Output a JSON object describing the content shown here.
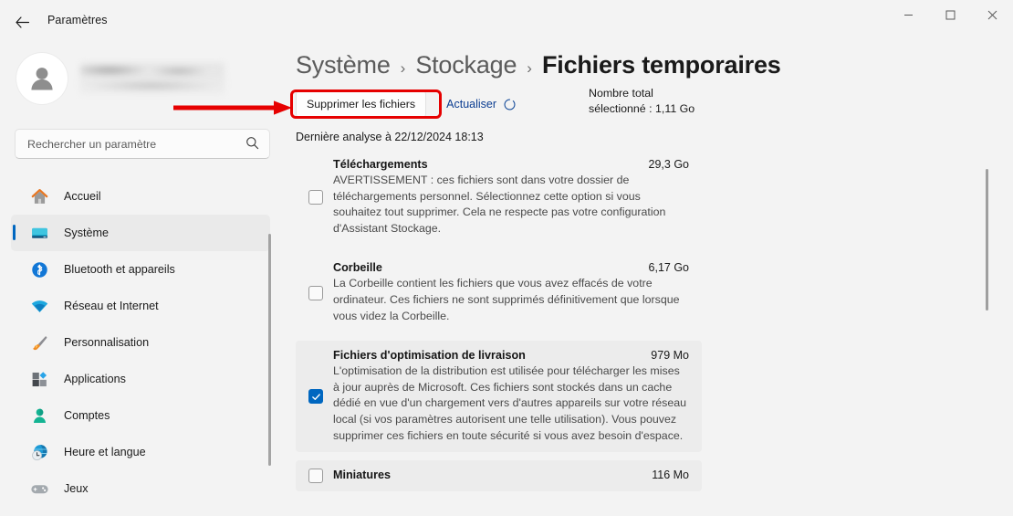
{
  "window": {
    "title": "Paramètres",
    "back_icon": "back-arrow-icon",
    "minimize_icon": "minimize-icon",
    "maximize_icon": "maximize-icon",
    "close_icon": "close-icon"
  },
  "sidebar": {
    "account": {
      "avatar_icon": "person-avatar-icon",
      "name_redacted": ""
    },
    "search": {
      "placeholder": "Rechercher un paramètre",
      "value": "",
      "icon": "search-icon"
    },
    "items": [
      {
        "label": "Accueil",
        "icon": "home-icon",
        "selected": false
      },
      {
        "label": "Système",
        "icon": "monitor-icon",
        "selected": true
      },
      {
        "label": "Bluetooth et appareils",
        "icon": "bluetooth-icon",
        "selected": false
      },
      {
        "label": "Réseau et Internet",
        "icon": "wifi-icon",
        "selected": false
      },
      {
        "label": "Personnalisation",
        "icon": "paintbrush-icon",
        "selected": false
      },
      {
        "label": "Applications",
        "icon": "apps-icon",
        "selected": false
      },
      {
        "label": "Comptes",
        "icon": "account-icon",
        "selected": false
      },
      {
        "label": "Heure et langue",
        "icon": "clock-globe-icon",
        "selected": false
      },
      {
        "label": "Jeux",
        "icon": "gamepad-icon",
        "selected": false
      }
    ]
  },
  "main": {
    "breadcrumb": {
      "parent": "Système",
      "middle": "Stockage",
      "current": "Fichiers temporaires",
      "separator": "›"
    },
    "delete_button": "Supprimer les fichiers",
    "refresh_link": "Actualiser",
    "refresh_icon": "refresh-spinner-icon",
    "total_label_line1": "Nombre total",
    "total_label_line2": "sélectionné : 1,11 Go",
    "last_scan": "Dernière analyse à 22/12/2024 18:13",
    "items": [
      {
        "title": "Téléchargements",
        "size": "29,3 Go",
        "checked": false,
        "highlight": false,
        "description": "AVERTISSEMENT : ces fichiers sont dans votre dossier de téléchargements personnel. Sélectionnez cette option si vous souhaitez tout supprimer. Cela ne respecte pas votre configuration d'Assistant Stockage."
      },
      {
        "title": "Corbeille",
        "size": "6,17 Go",
        "checked": false,
        "highlight": false,
        "description": "La Corbeille contient les fichiers que vous avez effacés de votre ordinateur. Ces fichiers ne sont supprimés définitivement que lorsque vous videz la Corbeille."
      },
      {
        "title": "Fichiers d'optimisation de livraison",
        "size": "979 Mo",
        "checked": true,
        "highlight": true,
        "description": "L'optimisation de la distribution est utilisée pour télécharger les mises à jour auprès de Microsoft. Ces fichiers sont stockés dans un cache dédié en vue d'un chargement vers d'autres appareils sur votre réseau local (si vos paramètres autorisent une telle utilisation). Vous pouvez supprimer ces fichiers en toute sécurité si vous avez besoin d'espace.",
        "checkbox_color": "#0067C0"
      },
      {
        "title": "Miniatures",
        "size": "116 Mo",
        "checked": false,
        "highlight": true,
        "description": ""
      }
    ]
  },
  "annotations": {
    "color": "#E60000",
    "arrow_target": "delete-files-button",
    "box_target": "delete-files-button"
  }
}
